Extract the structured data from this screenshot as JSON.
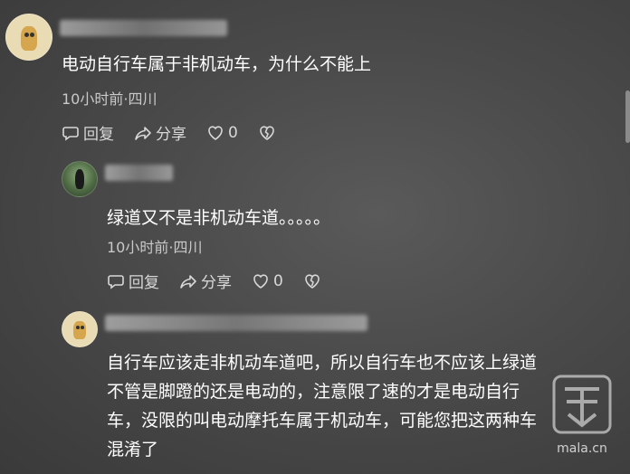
{
  "comments": [
    {
      "author_masked": "",
      "text": "电动自行车属于非机动车，为什么不能上",
      "time_location": "10小时前·四川",
      "reply_label": "回复",
      "share_label": "分享",
      "like_count": "0"
    },
    {
      "author_masked": "",
      "text": "绿道又不是非机动车道。。。。。",
      "time_location": "10小时前·四川",
      "reply_label": "回复",
      "share_label": "分享",
      "like_count": "0"
    },
    {
      "author_masked": "",
      "text_lines": [
        "自行车应该走非机动车道吧，所以自行车也不应该上绿道",
        "不管是脚蹬的还是电动的，注意限了速的才是电动自行",
        "车，没限的叫电动摩托车属于机动车，可能您把这两种车",
        "混淆了"
      ]
    }
  ],
  "watermark": {
    "domain": "mala.cn"
  },
  "colors": {
    "background": "#4a4a4a",
    "text": "#ffffff",
    "meta": "#c9c9c9"
  },
  "icons": [
    "reply-icon",
    "share-icon",
    "heart-icon",
    "broken-heart-icon"
  ]
}
